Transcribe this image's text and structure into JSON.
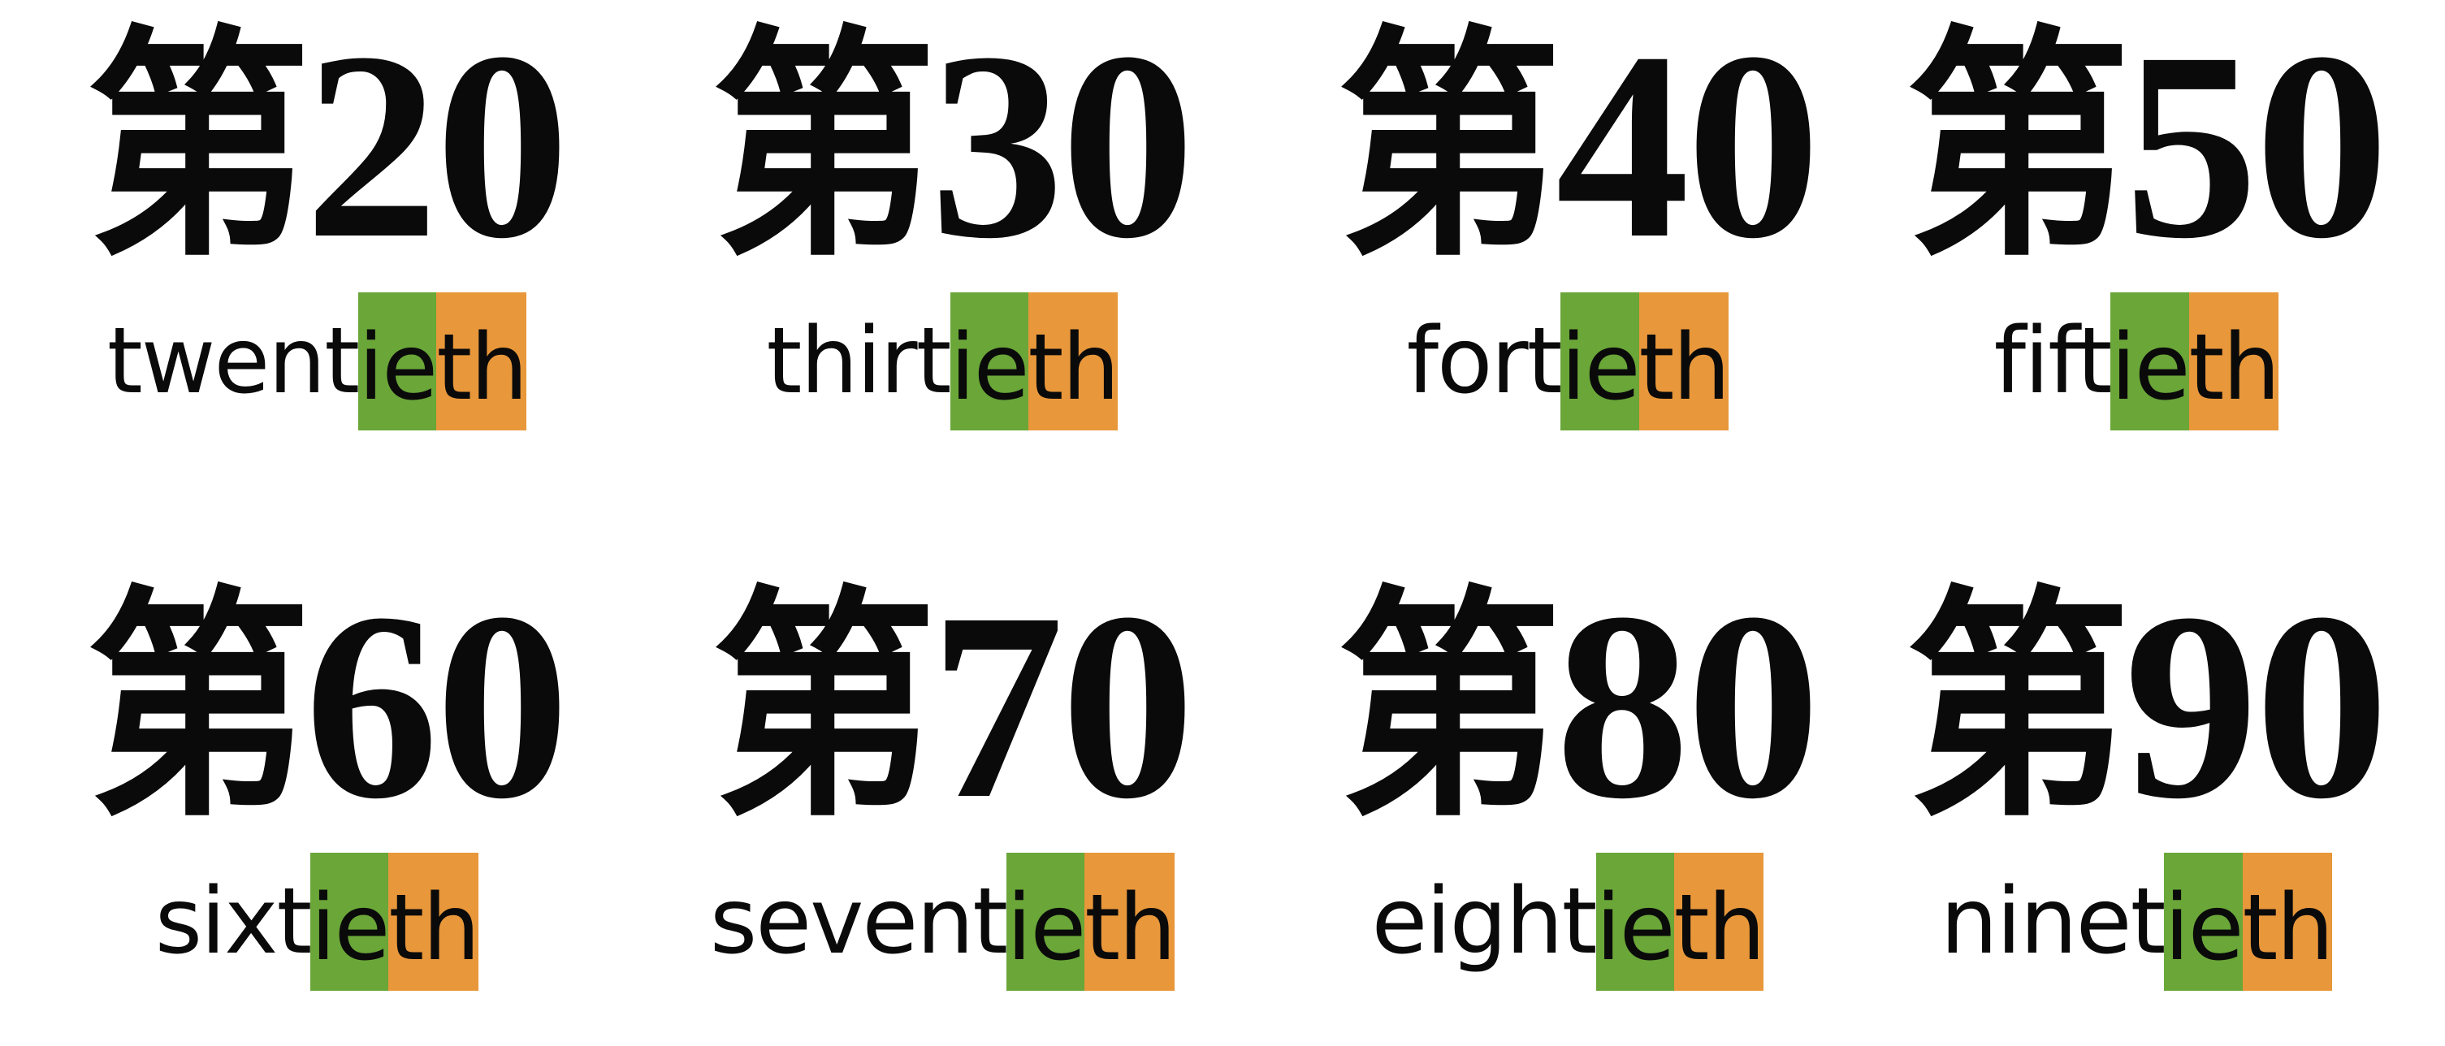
{
  "items": [
    {
      "prefix": "第",
      "number": "20",
      "stem": "twent",
      "mid": "ie",
      "suffix": "th"
    },
    {
      "prefix": "第",
      "number": "30",
      "stem": "thirt",
      "mid": "ie",
      "suffix": "th"
    },
    {
      "prefix": "第",
      "number": "40",
      "stem": "fort",
      "mid": "ie",
      "suffix": "th"
    },
    {
      "prefix": "第",
      "number": "50",
      "stem": "fift",
      "mid": "ie",
      "suffix": "th"
    },
    {
      "prefix": "第",
      "number": "60",
      "stem": "sixt",
      "mid": "ie",
      "suffix": "th"
    },
    {
      "prefix": "第",
      "number": "70",
      "stem": "sevent",
      "mid": "ie",
      "suffix": "th"
    },
    {
      "prefix": "第",
      "number": "80",
      "stem": "eight",
      "mid": "ie",
      "suffix": "th"
    },
    {
      "prefix": "第",
      "number": "90",
      "stem": "ninet",
      "mid": "ie",
      "suffix": "th"
    }
  ],
  "colors": {
    "ie_highlight": "#6aa638",
    "th_highlight": "#e8973a"
  }
}
